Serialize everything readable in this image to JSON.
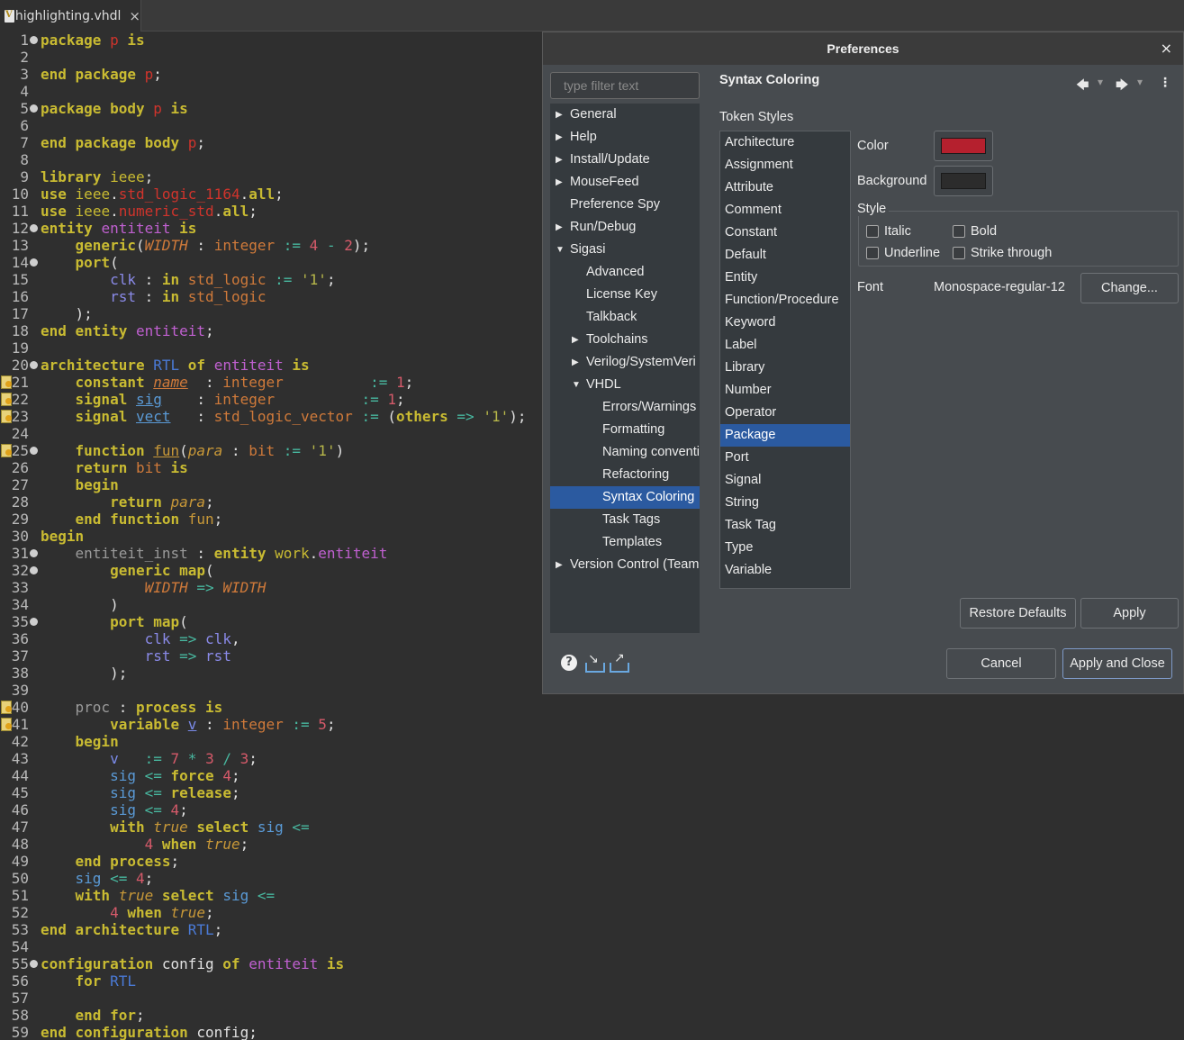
{
  "editor": {
    "tab_label": "highlighting.vhdl",
    "tab_close": "×"
  },
  "dialog": {
    "title": "Preferences",
    "close": "×",
    "filter_placeholder": "type filter text",
    "page_title": "Syntax Coloring",
    "nav": {
      "back": "🡄",
      "back_menu": "▾",
      "forward": "🡆",
      "forward_menu": "▾",
      "more": "⋮"
    },
    "tree": [
      {
        "label": "General",
        "arrow": "▶",
        "indent": 0
      },
      {
        "label": "Help",
        "arrow": "▶",
        "indent": 0
      },
      {
        "label": "Install/Update",
        "arrow": "▶",
        "indent": 0
      },
      {
        "label": "MouseFeed",
        "arrow": "▶",
        "indent": 0
      },
      {
        "label": "Preference Spy",
        "arrow": "",
        "indent": 0
      },
      {
        "label": "Run/Debug",
        "arrow": "▶",
        "indent": 0
      },
      {
        "label": "Sigasi",
        "arrow": "▼",
        "indent": 0
      },
      {
        "label": "Advanced",
        "arrow": "",
        "indent": 1
      },
      {
        "label": "License Key",
        "arrow": "",
        "indent": 1
      },
      {
        "label": "Talkback",
        "arrow": "",
        "indent": 1
      },
      {
        "label": "Toolchains",
        "arrow": "▶",
        "indent": 1
      },
      {
        "label": "Verilog/SystemVeri",
        "arrow": "▶",
        "indent": 1
      },
      {
        "label": "VHDL",
        "arrow": "▼",
        "indent": 1
      },
      {
        "label": "Errors/Warnings",
        "arrow": "",
        "indent": 2
      },
      {
        "label": "Formatting",
        "arrow": "",
        "indent": 2
      },
      {
        "label": "Naming conventi",
        "arrow": "",
        "indent": 2
      },
      {
        "label": "Refactoring",
        "arrow": "",
        "indent": 2
      },
      {
        "label": "Syntax Coloring",
        "arrow": "",
        "indent": 2,
        "selected": true
      },
      {
        "label": "Task Tags",
        "arrow": "",
        "indent": 2
      },
      {
        "label": "Templates",
        "arrow": "",
        "indent": 2
      },
      {
        "label": "Version Control (Team",
        "arrow": "▶",
        "indent": 0
      }
    ],
    "token_styles_label": "Token Styles",
    "token_styles": [
      "Architecture",
      "Assignment",
      "Attribute",
      "Comment",
      "Constant",
      "Default",
      "Entity",
      "Function/Procedure",
      "Keyword",
      "Label",
      "Library",
      "Number",
      "Operator",
      "Package",
      "Port",
      "Signal",
      "String",
      "Task Tag",
      "Type",
      "Variable"
    ],
    "selected_token": "Package",
    "color_label": "Color",
    "color_value": "#b5202e",
    "background_label": "Background",
    "background_value": "#2c2c2c",
    "style_label": "Style",
    "italic_label": "Italic",
    "bold_label": "Bold",
    "underline_label": "Underline",
    "strike_label": "Strike through",
    "font_label": "Font",
    "font_value": "Monospace-regular-12",
    "change_button": "Change...",
    "restore_button": "Restore Defaults",
    "apply_button": "Apply",
    "cancel_button": "Cancel",
    "apply_close_button": "Apply and Close"
  }
}
